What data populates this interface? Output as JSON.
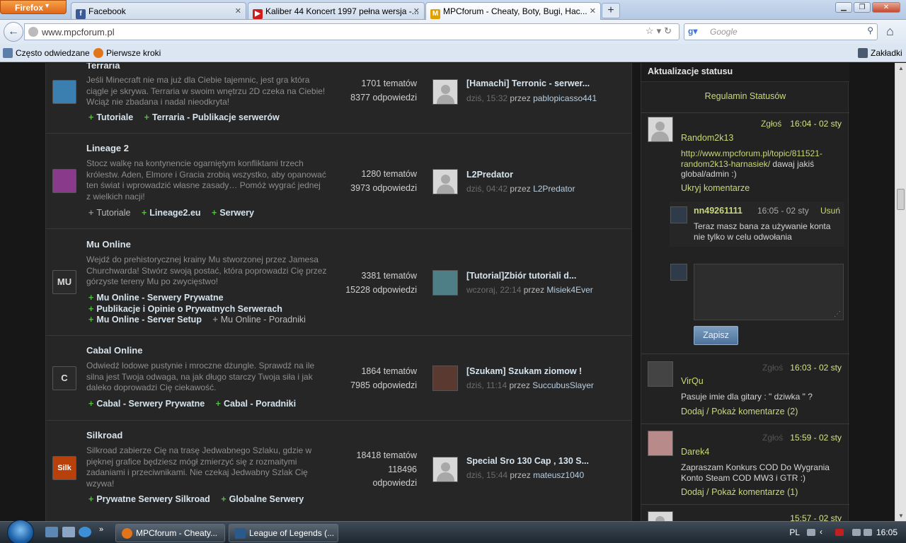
{
  "browser": {
    "menu_button": "Firefox",
    "tabs": [
      {
        "title": "Facebook",
        "icon": "facebook-icon",
        "color": "#3b5998"
      },
      {
        "title": "Kaliber 44 Koncert 1997 pełna wersja -...",
        "icon": "youtube-icon",
        "color": "#d11a1a"
      },
      {
        "title": "MPCforum - Cheaty, Boty, Bugi, Hac...",
        "icon": "mpcforum-icon",
        "color": "#e0a000"
      }
    ],
    "url": "www.mpcforum.pl",
    "search_placeholder": "Google",
    "bookmarks": [
      "Często odwiedzane",
      "Pierwsze kroki"
    ],
    "bookmarks_right": "Zakładki"
  },
  "forums": [
    {
      "title": "Terraria",
      "description": "Jeśli Minecraft nie ma już dla Ciebie tajemnic, jest gra która ciągle je skrywa. Terraria w swoim wnętrzu 2D czeka na Ciebie! Wciąż nie zbadana i nadal nieodkryta!",
      "subforums": [
        {
          "label": "Tutoriale"
        },
        {
          "label": "Terraria - Publikacje serwerów"
        }
      ],
      "topics": "1701 tematów",
      "replies": "8377 odpowiedzi",
      "last_title": "[Hamachi] Terronic - serwer...",
      "last_time": "dziś, 15:32",
      "last_user": "pablopicasso441",
      "icon_color": "#3a7fb0"
    },
    {
      "title": "Lineage 2",
      "description": "Stocz walkę na kontynencie ogarniętym konfliktami trzech królestw. Aden, Elmore i Gracia zrobią wszystko, aby opanować ten świat i wprowadzić własne zasady… Pomóż wygrać jednej z wielkich nacji!",
      "subforums": [
        {
          "label": "Tutoriale",
          "plain": true
        },
        {
          "label": "Lineage2.eu"
        },
        {
          "label": "Serwery"
        }
      ],
      "topics": "1280 tematów",
      "replies": "3973 odpowiedzi",
      "last_title": "L2Predator",
      "last_time": "dziś, 04:42",
      "last_user": "L2Predator",
      "icon_color": "#8a3a8a"
    },
    {
      "title": "Mu Online",
      "description": "Wejdź do prehistorycznej krainy Mu stworzonej przez Jamesa Churchwarda! Stwórz swoją postać, która poprowadzi Cię przez górzyste tereny Mu po zwycięstwo!",
      "subforums": [
        {
          "label": "Mu Online - Serwery Prywatne",
          "nl": true
        },
        {
          "label": "Publikacje i Opinie o Prywatnych Serwerach",
          "nl": true
        },
        {
          "label": "Mu Online - Server Setup"
        },
        {
          "label": "Mu Online - Poradniki",
          "plain": true
        }
      ],
      "topics": "3381 tematów",
      "replies": "15228 odpowiedzi",
      "last_title": "[Tutorial]Zbiór tutoriali d...",
      "last_time": "wczoraj, 22:14",
      "last_user": "Misiek4Ever",
      "icon_color": "#2a2a2a",
      "icon_text": "MU"
    },
    {
      "title": "Cabal Online",
      "description": "Odwiedź lodowe pustynie i mroczne dżungle. Sprawdź na ile silna jest Twoja odwaga, na jak długo starczy Twoja siła i jak daleko doprowadzi Cię ciekawość.",
      "subforums": [
        {
          "label": "Cabal - Serwery Prywatne"
        },
        {
          "label": "Cabal - Poradniki"
        }
      ],
      "topics": "1864 tematów",
      "replies": "7985 odpowiedzi",
      "last_title": "[Szukam] Szukam ziomow !",
      "last_time": "dziś, 11:14",
      "last_user": "SuccubusSlayer",
      "icon_color": "#2a2a2a",
      "icon_text": "C"
    },
    {
      "title": "Silkroad",
      "description": "Silkroad zabierze Cię na trasę Jedwabnego Szlaku, gdzie w pięknej grafice będziesz mógł zmierzyć się z rozmaitymi zadaniami i przeciwnikami. Nie czekaj Jedwabny Szlak Cię wzywa!",
      "subforums": [
        {
          "label": "Prywatne Serwery Silkroad"
        },
        {
          "label": "Globalne Serwery"
        }
      ],
      "topics": "18418 tematów",
      "replies": "118496",
      "replies2": "odpowiedzi",
      "last_title": "Special Sro 130 Cap , 130 S...",
      "last_time": "dziś, 15:44",
      "last_user": "mateusz1040",
      "icon_color": "#b8400a",
      "icon_text": "Silk"
    }
  ],
  "sidebar": {
    "title": "Aktualizacje statusu",
    "rules_link": "Regulamin Statusów",
    "statuses": [
      {
        "report": "Zgłoś",
        "time": "16:04 - 02 sty",
        "user": "Random2k13",
        "link_text": "http://www.mpcforum.pl/topic/811521-random2k13-harnasiek/",
        "text_after": "dawaj jakiś global/admin :)",
        "toggle": "Ukryj komentarze"
      },
      {
        "report": "Zgłoś",
        "time": "16:03 - 02 sty",
        "user": "VirQu",
        "text": "Pasuje imie dla gitary : \" dziwka \" ?",
        "toggle": "Dodaj / Pokaż komentarze (2)"
      },
      {
        "report": "Zgłoś",
        "time": "15:59 - 02 sty",
        "user": "Darek4",
        "text": "Zapraszam Konkurs COD Do Wygrania Konto Steam COD MW3 i GTR :)",
        "toggle": "Dodaj / Pokaż komentarze (1)"
      },
      {
        "time": "15:57 - 02 sty"
      }
    ],
    "reply": {
      "user": "nn49261111",
      "time": "16:05 - 02 sty",
      "delete": "Usuń",
      "text": "Teraz masz bana za używanie konta nie tylko w celu odwołania"
    },
    "save_button": "Zapisz"
  },
  "taskbar": {
    "windows": [
      "MPCforum - Cheaty...",
      "League of Legends (..."
    ],
    "lang": "PL",
    "clock": "16:05"
  }
}
